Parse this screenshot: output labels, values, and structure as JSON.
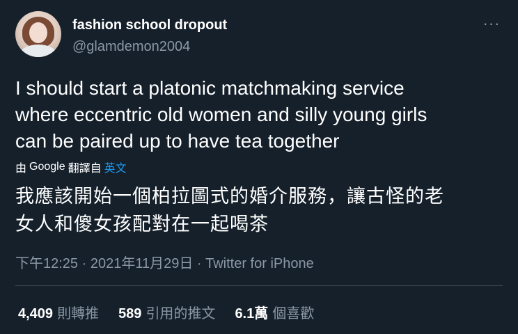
{
  "user": {
    "display_name": "fashion school dropout",
    "handle": "@glamdemon2004"
  },
  "menu": {
    "more_label": "···"
  },
  "tweet": {
    "text_lines": [
      "I should start a platonic matchmaking service",
      "where eccentric old women and silly young girls",
      "can be paired up to have tea together"
    ],
    "translation_prefix": "由",
    "translation_provider": "Google",
    "translation_middle": "翻譯自",
    "translation_lang": "英文",
    "translated_lines": [
      "我應該開始一個柏拉圖式的婚介服務，讓古怪的老",
      "女人和傻女孩配對在一起喝茶"
    ],
    "timestamp": "下午12:25 · 2021年11月29日 · Twitter for iPhone"
  },
  "stats": [
    {
      "num": "4,409",
      "label": "則轉推"
    },
    {
      "num": "589",
      "label": "引用的推文"
    },
    {
      "num": "6.1萬",
      "label": "個喜歡"
    }
  ]
}
